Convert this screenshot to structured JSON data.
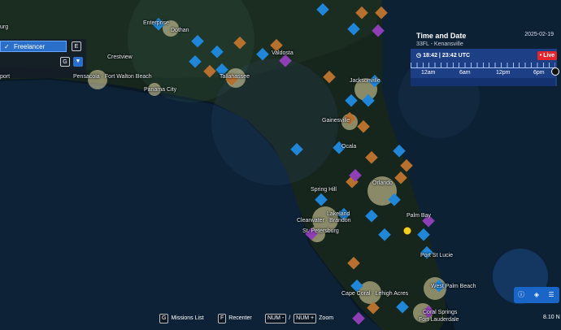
{
  "left_panel": {
    "partial_text_top": "urg",
    "freelancer_label": "Freelancer",
    "freelancer_key": "E",
    "missions_key": "G"
  },
  "cities": {
    "enterprise": "Enterprise",
    "dothan": "Dothan",
    "crestview": "Crestview",
    "pensacola_fwb": "Pensacola · Fort Walton Beach",
    "panama_city": "Panama City",
    "valdosta": "Valdosta",
    "tallahassee": "Tallahassee",
    "jacksonville": "Jacksonville",
    "gainesville": "Gainesville",
    "ocala": "Ocala",
    "spring_hill": "Spring Hill",
    "orlando": "Orlando",
    "lakeland": "Lakeland",
    "clearwater": "Clearwater · Brandon",
    "st_petersburg": "St. Petersburg",
    "palm_bay": "Palm Bay",
    "port_st_lucie": "Port St Lucie",
    "west_palm_beach": "West Palm Beach",
    "cape_coral": "Cape Coral · Lehigh Acres",
    "coral_springs": "Coral Springs",
    "fort_lauderdale": "Fort Lauderdale",
    "port_left": "port"
  },
  "time_panel": {
    "title": "Time and Date",
    "date": "2025-02-19",
    "location": "33FL - Kenansville",
    "clock": "18:42 | 23:42 UTC",
    "live_label": "• Live",
    "ticks": [
      "12am",
      "6am",
      "12pm",
      "6pm"
    ]
  },
  "bottom_bar": {
    "missions_key": "G",
    "missions_label": "Missions List",
    "recenter_key": "F",
    "recenter_label": "Recenter",
    "zoom_out_key": "NUM -",
    "separator": "/",
    "zoom_in_key": "NUM +",
    "zoom_label": "Zoom"
  },
  "map_toolbar": {
    "info_icon": "info-icon",
    "layers_icon": "layers-icon",
    "menu_icon": "menu-icon"
  },
  "scale": "8.10 N",
  "colors": {
    "accent": "#2a6fc9",
    "live": "#e3262e",
    "timeline": "#1c3f86",
    "marker_blue": "#1f86d8",
    "marker_orange": "#b8702e",
    "marker_purple": "#8e3fb5"
  }
}
